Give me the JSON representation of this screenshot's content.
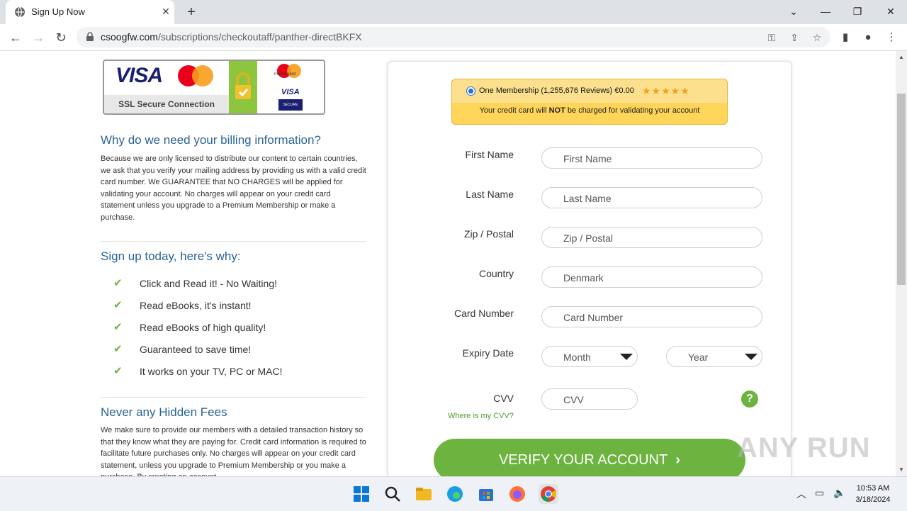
{
  "browser": {
    "tab_title": "Sign Up Now",
    "url_domain": "csoogfw.com",
    "url_path": "/subscriptions/checkoutaff/panther-directBKFX"
  },
  "badge": {
    "visa": "VISA",
    "ssl": "SSL Secure Connection",
    "mastercard_small": "mastercard",
    "visa_small": "VISA",
    "secure": "SECURE"
  },
  "left": {
    "billing_heading": "Why do we need your billing information?",
    "billing_text": "Because we are only licensed to distribute our content to certain countries, we ask that you verify your mailing address by providing us with a valid credit card number. We GUARANTEE that NO CHARGES will be applied for validating your account. No charges will appear on your credit card statement unless you upgrade to a Premium Membership or make a purchase.",
    "signup_heading": "Sign up today, here's why:",
    "reasons": [
      "Click and Read it! - No Waiting!",
      "Read eBooks, it's instant!",
      "Read eBooks of high quality!",
      "Guaranteed to save time!",
      "It works on your TV, PC or MAC!"
    ],
    "fees_heading": "Never any Hidden Fees",
    "fees_text": "We make sure to provide our members with a detailed transaction history so that they know what they are paying for. Credit card information is required to facilitate future purchases only. No charges will appear on your credit card statement, unless you upgrade to Premium Membership or you make a purchase. By creating an account"
  },
  "offer": {
    "name": "One Membership (1,255,676 Reviews) €0.00",
    "stars": "★★★★★",
    "rating": 5,
    "note_before": "Your credit card will ",
    "note_bold": "NOT",
    "note_after": " be charged for validating your account"
  },
  "form": {
    "first_name_label": "First Name",
    "first_name_placeholder": "First Name",
    "last_name_label": "Last Name",
    "last_name_placeholder": "Last Name",
    "zip_label": "Zip / Postal",
    "zip_placeholder": "Zip / Postal",
    "country_label": "Country",
    "country_value": "Denmark",
    "card_label": "Card Number",
    "card_placeholder": "Card Number",
    "expiry_label": "Expiry Date",
    "month_value": "Month",
    "year_value": "Year",
    "cvv_label": "CVV",
    "cvv_placeholder": "CVV",
    "cvv_help": "?",
    "cvv_link": "Where is my CVV?",
    "verify_label": "VERIFY YOUR ACCOUNT",
    "verify_arrow": "›"
  },
  "watermark": "ANY RUN",
  "taskbar": {
    "time": "10:53 AM",
    "date": "3/18/2024"
  },
  "colors": {
    "accent_green": "#6db33f",
    "heading_blue": "#2a6496",
    "offer_yellow": "#ffd55a"
  }
}
